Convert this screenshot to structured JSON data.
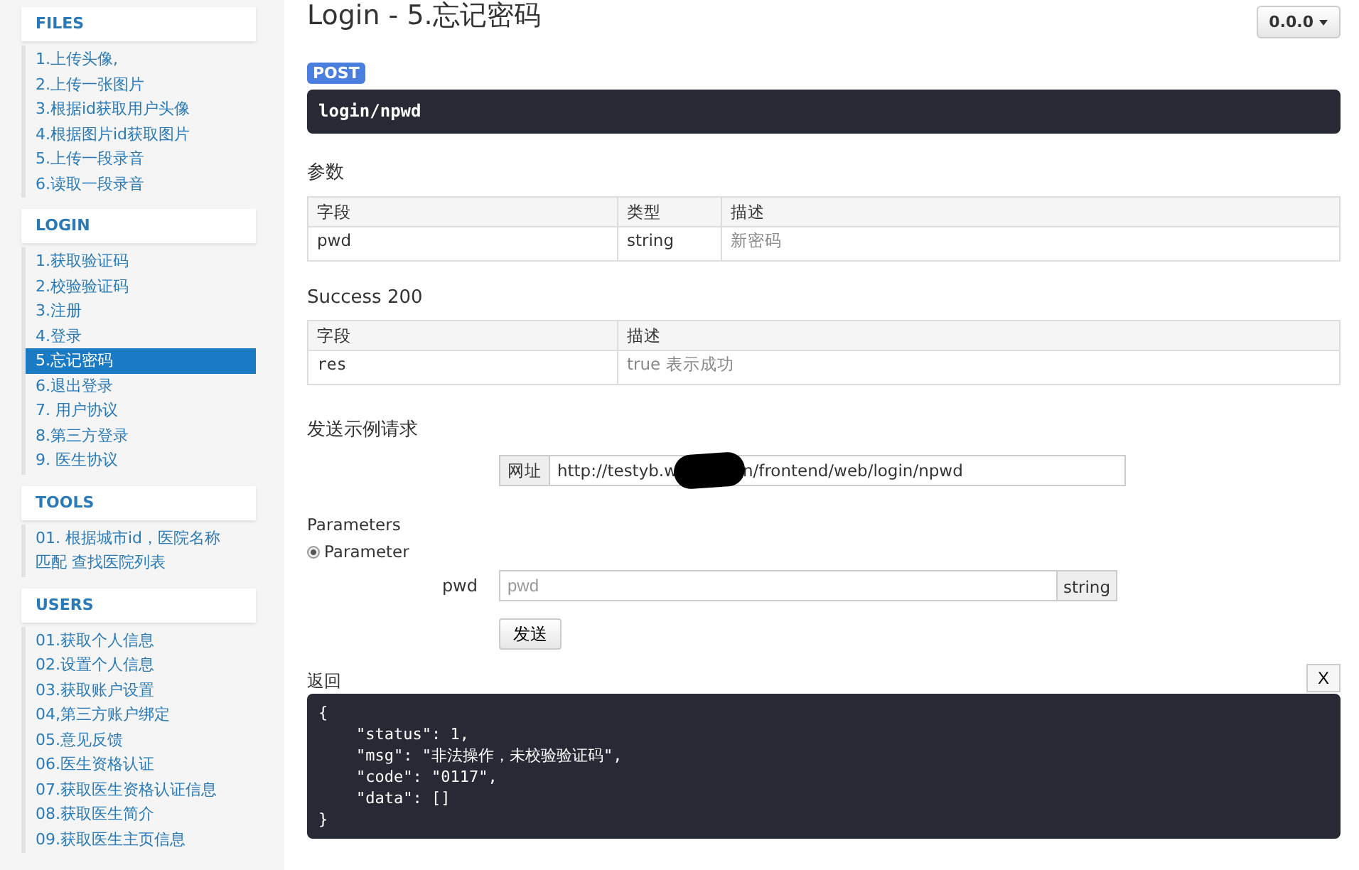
{
  "sidebar": {
    "sections": [
      {
        "title": "FILES",
        "items": [
          {
            "label": "1.上传头像,",
            "selected": false
          },
          {
            "label": "2.上传一张图片",
            "selected": false
          },
          {
            "label": "3.根据id获取用户头像",
            "selected": false
          },
          {
            "label": "4.根据图片id获取图片",
            "selected": false
          },
          {
            "label": "5.上传一段录音",
            "selected": false
          },
          {
            "label": "6.读取一段录音",
            "selected": false
          }
        ]
      },
      {
        "title": "LOGIN",
        "items": [
          {
            "label": "1.获取验证码",
            "selected": false
          },
          {
            "label": "2.校验验证码",
            "selected": false
          },
          {
            "label": "3.注册",
            "selected": false
          },
          {
            "label": "4.登录",
            "selected": false
          },
          {
            "label": "5.忘记密码",
            "selected": true
          },
          {
            "label": "6.退出登录",
            "selected": false
          },
          {
            "label": "7. 用户协议",
            "selected": false
          },
          {
            "label": "8.第三方登录",
            "selected": false
          },
          {
            "label": "9. 医生协议",
            "selected": false
          }
        ]
      },
      {
        "title": "TOOLS",
        "items": [
          {
            "label": "01. 根据城市id，医院名称匹配 查找医院列表",
            "selected": false
          }
        ]
      },
      {
        "title": "USERS",
        "items": [
          {
            "label": "01.获取个人信息",
            "selected": false
          },
          {
            "label": "02.设置个人信息",
            "selected": false
          },
          {
            "label": "03.获取账户设置",
            "selected": false
          },
          {
            "label": "04,第三方账户绑定",
            "selected": false
          },
          {
            "label": "05.意见反馈",
            "selected": false
          },
          {
            "label": "06.医生资格认证",
            "selected": false
          },
          {
            "label": "07.获取医生资格认证信息",
            "selected": false
          },
          {
            "label": "08.获取医生简介",
            "selected": false
          },
          {
            "label": "09.获取医生主页信息",
            "selected": false
          }
        ]
      }
    ]
  },
  "header": {
    "title": "Login - 5.忘记密码",
    "version": "0.0.0"
  },
  "endpoint": {
    "method": "POST",
    "path": "login/npwd"
  },
  "params": {
    "heading": "参数",
    "columns": [
      "字段",
      "类型",
      "描述"
    ],
    "rows": [
      [
        "pwd",
        "string",
        "新密码"
      ]
    ]
  },
  "success": {
    "heading": "Success 200",
    "columns": [
      "字段",
      "描述"
    ],
    "rows": [
      [
        "res",
        "true 表示成功"
      ]
    ]
  },
  "sample": {
    "heading": "发送示例请求",
    "url_label": "网址",
    "url_start": "http://testyb.w",
    "url_end": "n/frontend/web/login/npwd"
  },
  "parameters": {
    "heading": "Parameters",
    "option": {
      "label": "Parameter",
      "selected": true
    },
    "field": {
      "label": "pwd",
      "placeholder": "pwd",
      "type": "string"
    },
    "send": "发送"
  },
  "response": {
    "heading": "返回",
    "close": "X",
    "lines": [
      "{",
      "    \"status\": 1,",
      "    \"msg\": \"非法操作，未校验验证码\",",
      "    \"code\": \"0117\",",
      "    \"data\": []",
      "}"
    ]
  }
}
